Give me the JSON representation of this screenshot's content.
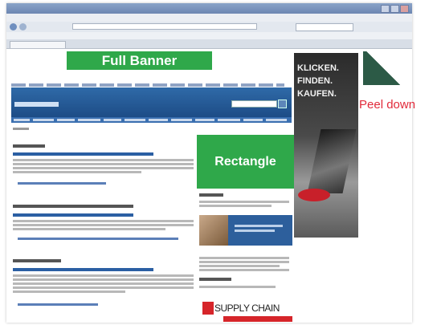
{
  "ads": {
    "full_banner": "Full Banner",
    "rectangle": "Rectangle",
    "peel_down": "Peel down",
    "skyscraper_text": "KLICKEN. FINDEN. KAUFEN."
  },
  "page": {
    "supply_chain": "SUPPLY CHAIN"
  },
  "colors": {
    "ad_green": "#2fa84a",
    "header_blue": "#1d4c86",
    "peel_label_red": "#e12a3a"
  }
}
